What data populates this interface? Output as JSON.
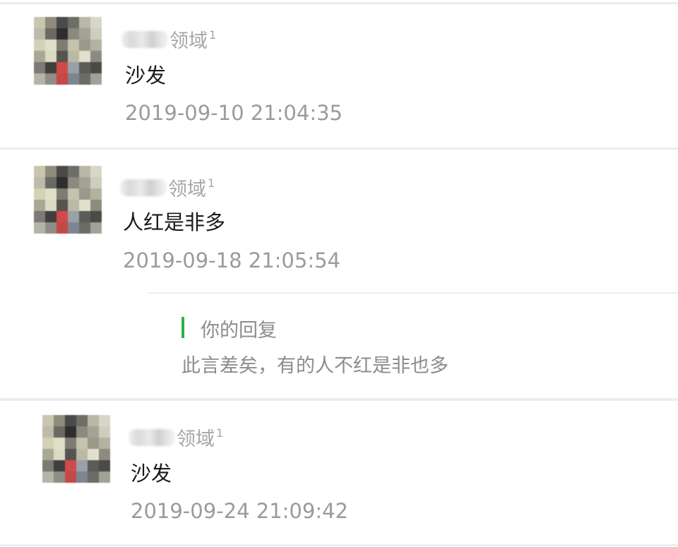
{
  "comments": [
    {
      "nickname": "领域",
      "level": "1",
      "content": "沙发",
      "time": "2019-09-10 21:04:35"
    },
    {
      "nickname": "领域",
      "level": "1",
      "content": "人红是非多",
      "time": "2019-09-18 21:05:54",
      "reply": {
        "title": "你的回复",
        "text": "此言差矣，有的人不红是非也多"
      }
    },
    {
      "nickname": "领域",
      "level": "1",
      "content": "沙发",
      "time": "2019-09-24 21:09:42"
    }
  ],
  "colors": {
    "reply_accent": "#2ab34a",
    "separator": "#e8eef2",
    "timestamp": "#9b9b9b"
  },
  "icons": {
    "avatar": "pixelated-avatar-icon"
  }
}
